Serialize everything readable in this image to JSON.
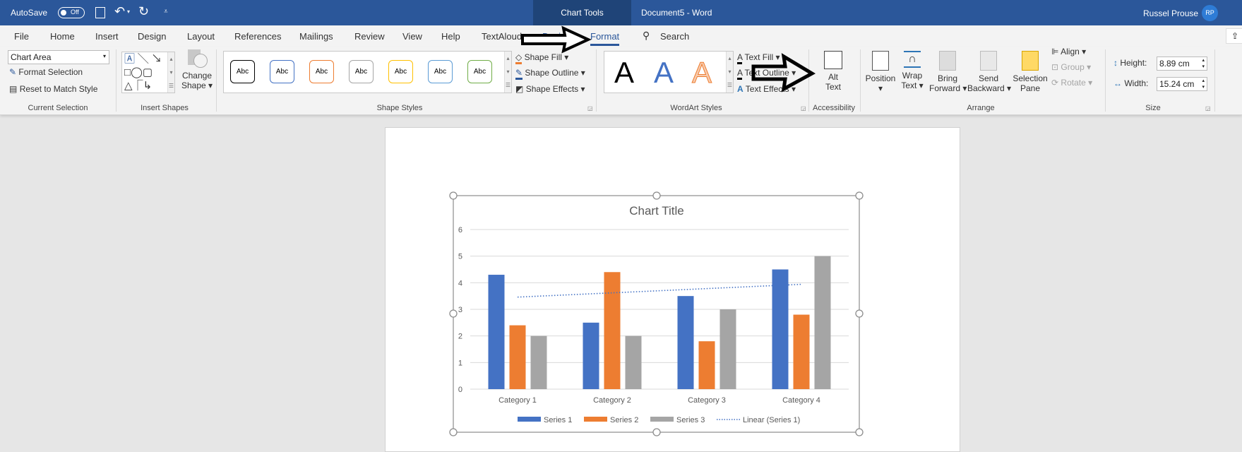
{
  "titlebar": {
    "autosave_label": "AutoSave",
    "autosave_state": "Off",
    "context_tab": "Chart Tools",
    "document_title": "Document5  -  Word",
    "user_name": "Russel Prouse",
    "user_initials": "RP",
    "brand_color": "#2b579a"
  },
  "tabs": [
    {
      "label": "File"
    },
    {
      "label": "Home"
    },
    {
      "label": "Insert"
    },
    {
      "label": "Design"
    },
    {
      "label": "Layout"
    },
    {
      "label": "References"
    },
    {
      "label": "Mailings"
    },
    {
      "label": "Review"
    },
    {
      "label": "View"
    },
    {
      "label": "Help"
    },
    {
      "label": "TextAloud"
    },
    {
      "label": "Design"
    },
    {
      "label": "Format",
      "active": true
    }
  ],
  "search": {
    "label": "Search"
  },
  "ribbon": {
    "current_selection": {
      "dropdown_value": "Chart Area",
      "format_selection": "Format Selection",
      "reset": "Reset to Match Style",
      "label": "Current Selection"
    },
    "insert_shapes": {
      "change_shape_1": "Change",
      "change_shape_2": "Shape",
      "label": "Insert Shapes"
    },
    "shape_styles": {
      "preset_text": "Abc",
      "preset_colors": [
        "#000000",
        "#4472c4",
        "#ed7d31",
        "#a5a5a5",
        "#ffc000",
        "#5b9bd5",
        "#70ad47"
      ],
      "shape_fill": "Shape Fill",
      "shape_outline": "Shape Outline",
      "shape_effects": "Shape Effects",
      "label": "Shape Styles"
    },
    "wordart_styles": {
      "letter": "A",
      "text_fill": "Text Fill",
      "text_outline": "Text Outline",
      "text_effects": "Text Effects",
      "label": "WordArt Styles"
    },
    "accessibility": {
      "alt_text_1": "Alt",
      "alt_text_2": "Text",
      "label": "Accessibility"
    },
    "arrange": {
      "position": "Position",
      "wrap_1": "Wrap",
      "wrap_2": "Text",
      "bring_1": "Bring",
      "bring_2": "Forward",
      "send_1": "Send",
      "send_2": "Backward",
      "selection_1": "Selection",
      "selection_2": "Pane",
      "align": "Align",
      "group": "Group",
      "rotate": "Rotate",
      "label": "Arrange"
    },
    "size": {
      "height_label": "Height:",
      "height_value": "8.89 cm",
      "width_label": "Width:",
      "width_value": "15.24 cm",
      "label": "Size"
    }
  },
  "chart_data": {
    "type": "bar",
    "title": "Chart Title",
    "categories": [
      "Category 1",
      "Category 2",
      "Category 3",
      "Category 4"
    ],
    "series": [
      {
        "name": "Series 1",
        "values": [
          4.3,
          2.5,
          3.5,
          4.5
        ],
        "color": "#4472c4"
      },
      {
        "name": "Series 2",
        "values": [
          2.4,
          4.4,
          1.8,
          2.8
        ],
        "color": "#ed7d31"
      },
      {
        "name": "Series 3",
        "values": [
          2,
          2,
          3,
          5
        ],
        "color": "#a5a5a5"
      }
    ],
    "trendline": {
      "name": "Linear (Series 1)",
      "of_series": "Series 1",
      "type": "linear",
      "style": "dotted",
      "color": "#4472c4"
    },
    "ylim": [
      0,
      6
    ],
    "yticks": [
      "0",
      "1",
      "2",
      "3",
      "4",
      "5",
      "6"
    ],
    "grid": true,
    "legend": "bottom"
  }
}
